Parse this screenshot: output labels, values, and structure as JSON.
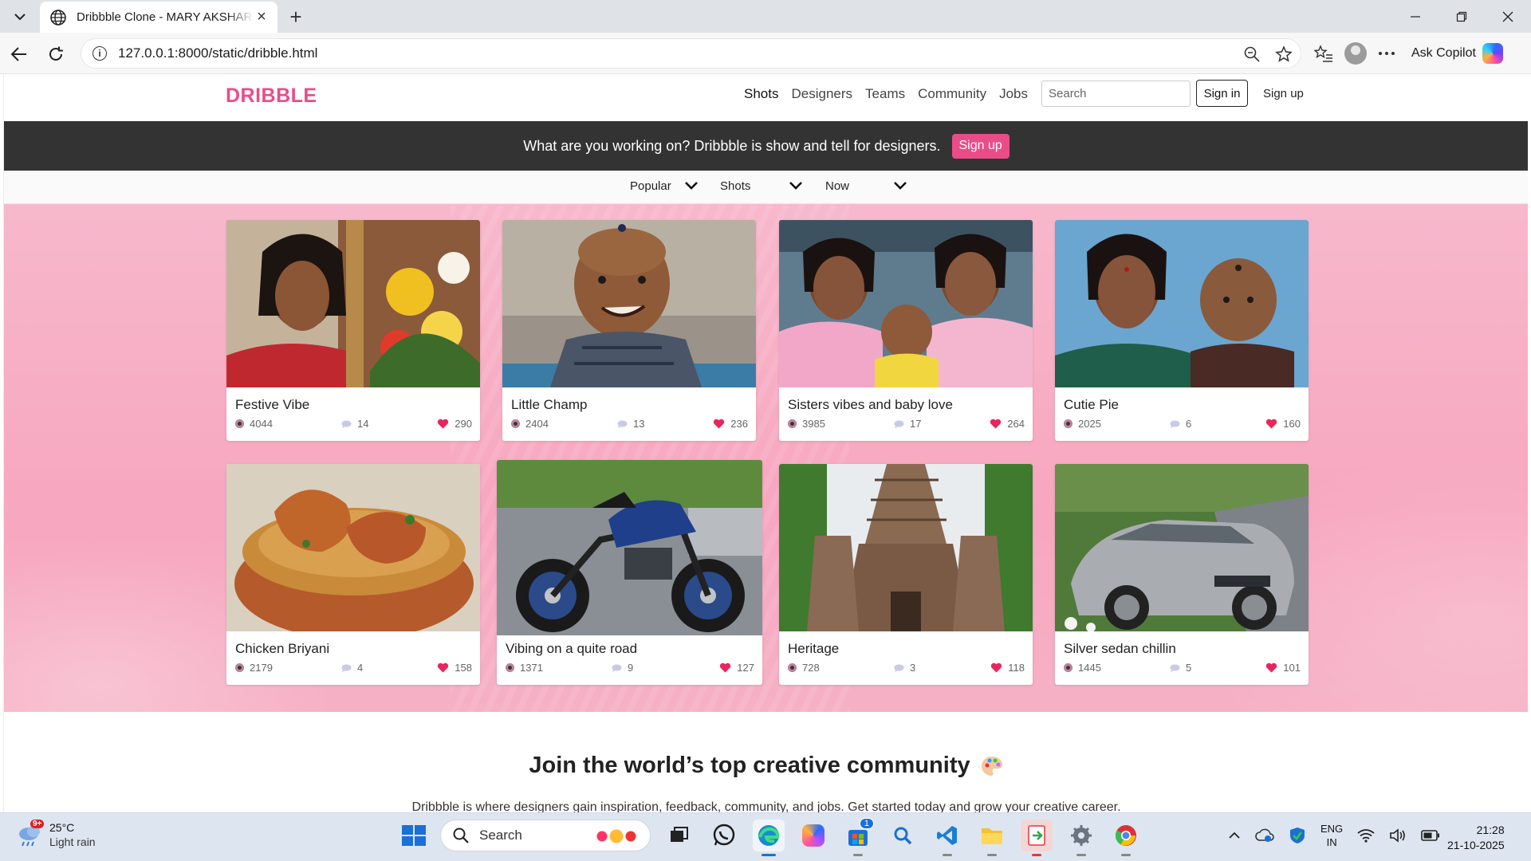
{
  "browser": {
    "tab_title": "Dribbble Clone - MARY AKSHARA",
    "url": "127.0.0.1:8000/static/dribble.html",
    "copilot_label": "Ask Copilot"
  },
  "site": {
    "logo": "DRIBBLE",
    "nav": [
      "Shots",
      "Designers",
      "Teams",
      "Community",
      "Jobs"
    ],
    "search_placeholder": "Search",
    "sign_in": "Sign in",
    "sign_up": "Sign up"
  },
  "banner": {
    "text": "What are you working on? Dribbble is show and tell for designers.",
    "button": "Sign up"
  },
  "filters": {
    "sort": "Popular",
    "type": "Shots",
    "time": "Now"
  },
  "shots": [
    {
      "title": "Festive Vibe",
      "views": "4044",
      "comments": "14",
      "likes": "290",
      "image": "woman-with-flowers"
    },
    {
      "title": "Little Champ",
      "views": "2404",
      "comments": "13",
      "likes": "236",
      "image": "smiling-boy"
    },
    {
      "title": "Sisters vibes and baby love",
      "views": "3985",
      "comments": "17",
      "likes": "264",
      "image": "sisters-with-baby"
    },
    {
      "title": "Cutie Pie",
      "views": "2025",
      "comments": "6",
      "likes": "160",
      "image": "mother-and-baby"
    },
    {
      "title": "Chicken Briyani",
      "views": "2179",
      "comments": "4",
      "likes": "158",
      "image": "biryani-bowl"
    },
    {
      "title": "Vibing on a quite road",
      "views": "1371",
      "comments": "9",
      "likes": "127",
      "image": "blue-motorcycle"
    },
    {
      "title": "Heritage",
      "views": "728",
      "comments": "3",
      "likes": "118",
      "image": "temple-tower"
    },
    {
      "title": "Silver sedan chillin",
      "views": "1445",
      "comments": "5",
      "likes": "101",
      "image": "silver-sedan"
    }
  ],
  "join": {
    "title": "Join the world’s top creative community",
    "subtitle": "Dribbble is where designers gain inspiration, feedback, community, and jobs. Get started today and grow your creative career."
  },
  "taskbar": {
    "temperature": "25°C",
    "condition": "Light rain",
    "weather_badge": "9+",
    "search_label": "Search",
    "store_badge": "1",
    "lang_top": "ENG",
    "lang_bottom": "IN",
    "time": "21:28",
    "date": "21-10-2025"
  },
  "colors": {
    "brand": "#ea4c89",
    "banner_bg": "#333333",
    "gallery_bg": "#f7a7c0"
  }
}
